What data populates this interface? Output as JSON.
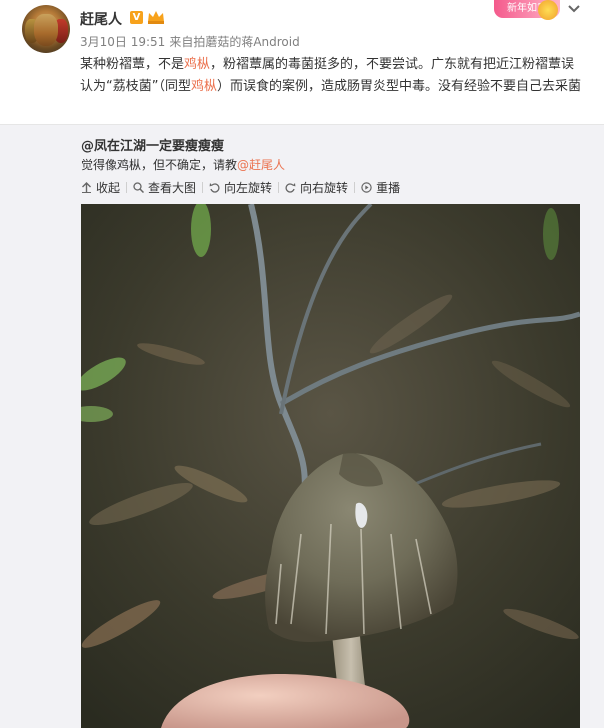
{
  "post": {
    "username": "赶尾人",
    "verified_badge": "V",
    "date": "3月10日 19:51",
    "via_prefix": "来自",
    "source": "拍蘑菇的蒋Android",
    "promo": "新年如意",
    "text_parts": [
      "某种粉褶蕈，不是",
      "鸡枞",
      "，粉褶蕈属的毒菌挺多的，不要尝试。广东就有把近江粉褶蕈误认为“荔枝菌”（同型",
      "鸡枞",
      "）而误食的案例，造成肠胃炎型中毒。没有经验不要自己去采菌"
    ]
  },
  "repost": {
    "source_user": "@凤在江湖一定要瘦瘦瘦",
    "source_text": "觉得像鸡枞，但不确定，请教",
    "mention": "@赶尾人",
    "tools": {
      "collapse": "收起",
      "view_large": "查看大图",
      "rotate_left": "向左旋转",
      "rotate_right": "向右旋转",
      "replay": "重播"
    }
  },
  "icons": [
    "collapse-arrow-icon",
    "zoom-icon",
    "rotate-left-icon",
    "rotate-right-icon",
    "replay-icon",
    "chevron-down-icon",
    "crown-icon"
  ],
  "colors": {
    "highlight": "#eb7350",
    "meta": "#808080",
    "repost_bg": "#f2f2f5"
  }
}
